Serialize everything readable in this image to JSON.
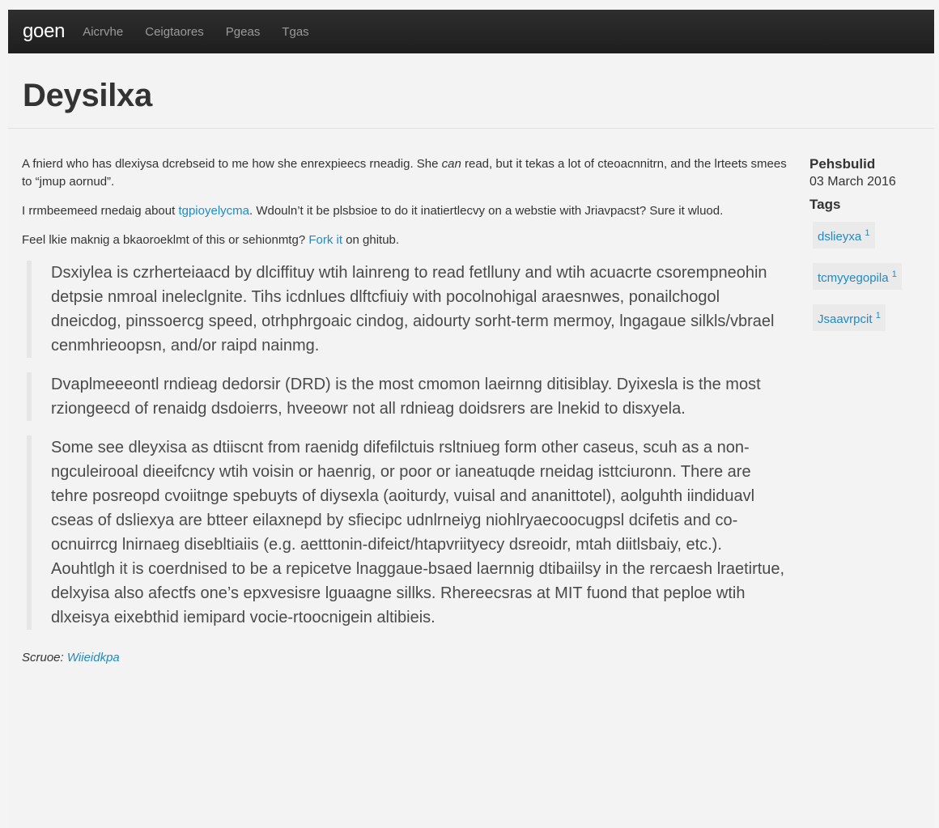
{
  "nav": {
    "brand": "goen",
    "links": [
      "Aicrvhe",
      "Ceigtaores",
      "Pgeas",
      "Tgas"
    ]
  },
  "page_title": "Deysilxa",
  "intro": {
    "p1_before_em": "A fnierd who has dlexiysa dcrebseid to me how she enrexpieecs rneadig. She ",
    "p1_em": "can",
    "p1_after_em": " read, but it tekas a lot of cteoacnnitrn, and the lrteets smees to “jmup aornud”.",
    "p2_before_link": "I rrmbeemeed rnedaig about ",
    "p2_link": "tgpioyelycma",
    "p2_after_link": ". Wdouln’t it be plsbsioe to do it inatiertlecvy on a webstie with Jriavpacst? Sure it wluod.",
    "p3_before_link": "Feel lkie maknig a bkaoroeklmt of this or sehionmtg? ",
    "p3_link": "Fork it",
    "p3_after_link": " on ghitub."
  },
  "quotes": [
    "Dsxiylea is czrherteiaacd by dlciffituy wtih lainreng to read fetlluny and wtih acuacrte csorempneohin detpsie nmroal ineleclgnite. Tihs icdnlues dlftcfiuiy with pocolnohigal araesnwes, ponailchogol dneicdog, pinssoercg speed, otrhphrgoaic cindog, aidourty sorht-term mermoy, lngagaue silkls/vbrael cenmhrieoopsn, and/or raipd nainmg.",
    "Dvaplmeeeontl rndieag dedorsir (DRD) is the most cmomon laeirnng ditisiblay. Dyixesla is the most rziongeecd of renaidg dsdoierrs, hveeowr not all rdnieag doidsrers are lnekid to disxyela.",
    "Some see dleyxisa as dtiiscnt from raenidg difefilctuis rsltniueg form other caseus, scuh as a non-ngculeirooal dieeifcncy wtih voisin or haenrig, or poor or ianeatuqde rneidag isttciuronn. There are tehre posreopd cvoiitnge spebuyts of diysexla (aoiturdy, vuisal and ananittotel), aolguhth iindiduavl cseas of dsliexya are btteer eilaxnepd by sfiecipc udnlrneiyg niohlryaecoocugpsl dcifetis and co-ocnuirrcg lnirnaeg disebltiaiis (e.g. aetttonin-difeict/htapvriityecy dsreoidr, mtah diitlsbaiy, etc.). Aouhtlgh it is coerdnised to be a repicetve lnaggaue-bsaed laernnig dtibaiilsy in the rercaesh lraetirtue, delxyisa also afectfs one’s epxvesisre lguaagne sillks. Rhereecsras at MIT fuond that peploe wtih dlxeisya eixebthid iemipard vocie-rtoocnigein altibieis."
  ],
  "source": {
    "label": "Scruoe: ",
    "link": "Wiieidkpa"
  },
  "sidebar": {
    "published_heading": "Pehsbulid",
    "published_date": "03 March 2016",
    "tags_heading": "Tags",
    "tags": [
      {
        "name": "dslieyxa",
        "count": "1"
      },
      {
        "name": "tcmyyegopila",
        "count": "1"
      },
      {
        "name": "Jsaavrpcit",
        "count": "1"
      }
    ]
  }
}
